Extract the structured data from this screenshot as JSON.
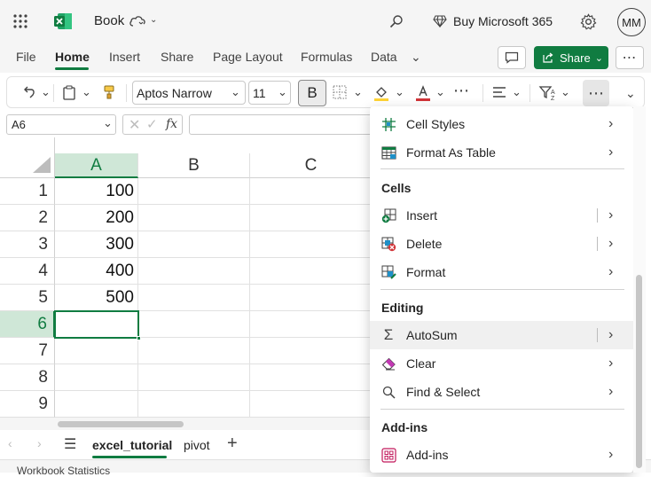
{
  "title_bar": {
    "app_name": "Book",
    "buy_label": "Buy Microsoft 365",
    "avatar_initials": "MM"
  },
  "menu": {
    "items": [
      "File",
      "Home",
      "Insert",
      "Share",
      "Page Layout",
      "Formulas",
      "Data"
    ],
    "active": "Home",
    "share_label": "Share"
  },
  "ribbon": {
    "font_name": "Aptos Narrow",
    "font_size": "11",
    "bold_label": "B"
  },
  "formula_bar": {
    "name_box": "A6",
    "fx_label": "fx",
    "formula": ""
  },
  "grid": {
    "columns": [
      "A",
      "B",
      "C"
    ],
    "rows": [
      "1",
      "2",
      "3",
      "4",
      "5",
      "6",
      "7",
      "8",
      "9"
    ],
    "col_a_values": [
      "100",
      "200",
      "300",
      "400",
      "500",
      "",
      "",
      "",
      ""
    ],
    "active_cell": "A6"
  },
  "dropdown": {
    "top_items": [
      {
        "label": "Cell Styles",
        "icon": "cell-styles-icon"
      },
      {
        "label": "Format As Table",
        "icon": "format-table-icon"
      }
    ],
    "cells_header": "Cells",
    "cells_items": [
      {
        "label": "Insert",
        "icon": "insert-cells-icon"
      },
      {
        "label": "Delete",
        "icon": "delete-cells-icon"
      },
      {
        "label": "Format",
        "icon": "format-cells-icon"
      }
    ],
    "editing_header": "Editing",
    "editing_items": [
      {
        "label": "AutoSum",
        "icon": "autosum-icon"
      },
      {
        "label": "Clear",
        "icon": "eraser-icon"
      },
      {
        "label": "Find & Select",
        "icon": "search-icon"
      }
    ],
    "addins_header": "Add-ins",
    "addins_items": [
      {
        "label": "Add-ins",
        "icon": "addins-icon"
      }
    ]
  },
  "sheets": {
    "tabs": [
      "excel_tutorial",
      "pivot"
    ],
    "active": "excel_tutorial"
  },
  "status": {
    "text": "Workbook Statistics"
  },
  "colors": {
    "excel_green": "#107c41",
    "selection_green": "#cfe7d7",
    "delete_red": "#d13438",
    "font_red": "#d13438",
    "highlight_yellow": "#ffd335"
  }
}
